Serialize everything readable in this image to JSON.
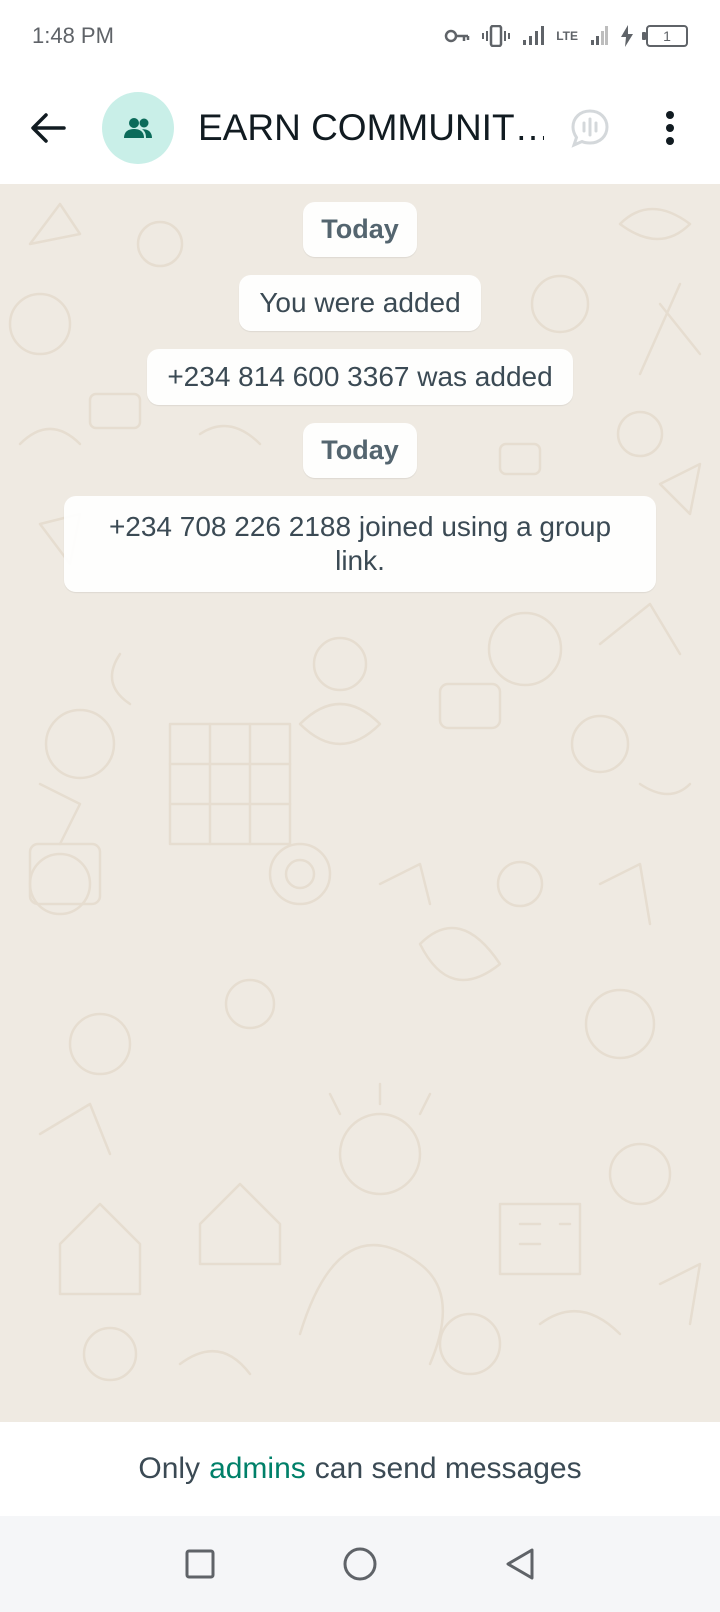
{
  "status_bar": {
    "time": "1:48 PM",
    "lte": "LTE",
    "battery": "1"
  },
  "header": {
    "title": "EARN COMMUNIT…",
    "avatar_icon": "group-icon"
  },
  "messages": [
    {
      "type": "date",
      "text": "Today"
    },
    {
      "type": "system",
      "text": "You were added"
    },
    {
      "type": "system",
      "text": "+234 814 600 3367 was added"
    },
    {
      "type": "date",
      "text": "Today"
    },
    {
      "type": "system",
      "text": "+234 708 226 2188 joined using a group link."
    }
  ],
  "footer": {
    "prefix": "Only",
    "link": "admins",
    "suffix": "can send messages"
  },
  "colors": {
    "accent": "#008069",
    "chat_bg": "#efeae2",
    "avatar_bg": "#c9efe8"
  }
}
